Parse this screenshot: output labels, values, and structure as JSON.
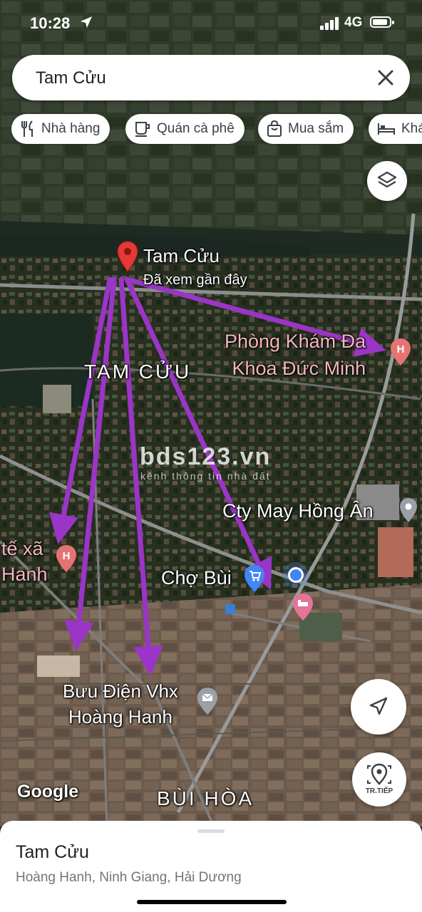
{
  "status_bar": {
    "time": "10:28",
    "network": "4G"
  },
  "search": {
    "query": "Tam Cửu"
  },
  "chips": [
    {
      "label": "Nhà hàng",
      "icon": "fork-knife-icon"
    },
    {
      "label": "Quán cà phê",
      "icon": "coffee-cup-icon"
    },
    {
      "label": "Mua sắm",
      "icon": "shopping-bag-icon"
    },
    {
      "label": "Khá",
      "icon": "bed-icon"
    }
  ],
  "map": {
    "pin": {
      "title": "Tam Cửu",
      "subtitle": "Đã xem gần đây"
    },
    "area_labels": [
      "TAM CỬU",
      "BÙI HÒA"
    ],
    "pois": {
      "clinic": "Phòng Khám Đa\nKhoa Đức Minh",
      "company": "Cty May Hồng Ân",
      "market": "Chợ Bùi",
      "health_station": "tế xã\nHanh",
      "post_office": "Bưu Điện Vhx\nHoàng Hanh"
    },
    "watermark": {
      "title": "bds123.vn",
      "subtitle": "kênh thông tin nhà đất"
    },
    "google_logo": "Google",
    "next_button_label": "TR.TIẾP",
    "accent_colors": {
      "pin": "#e53935",
      "arrows": "#9a35c7",
      "my_location": "#4285f4"
    }
  },
  "place_sheet": {
    "title": "Tam Cửu",
    "address": "Hoàng Hanh, Ninh Giang, Hải Dương"
  }
}
